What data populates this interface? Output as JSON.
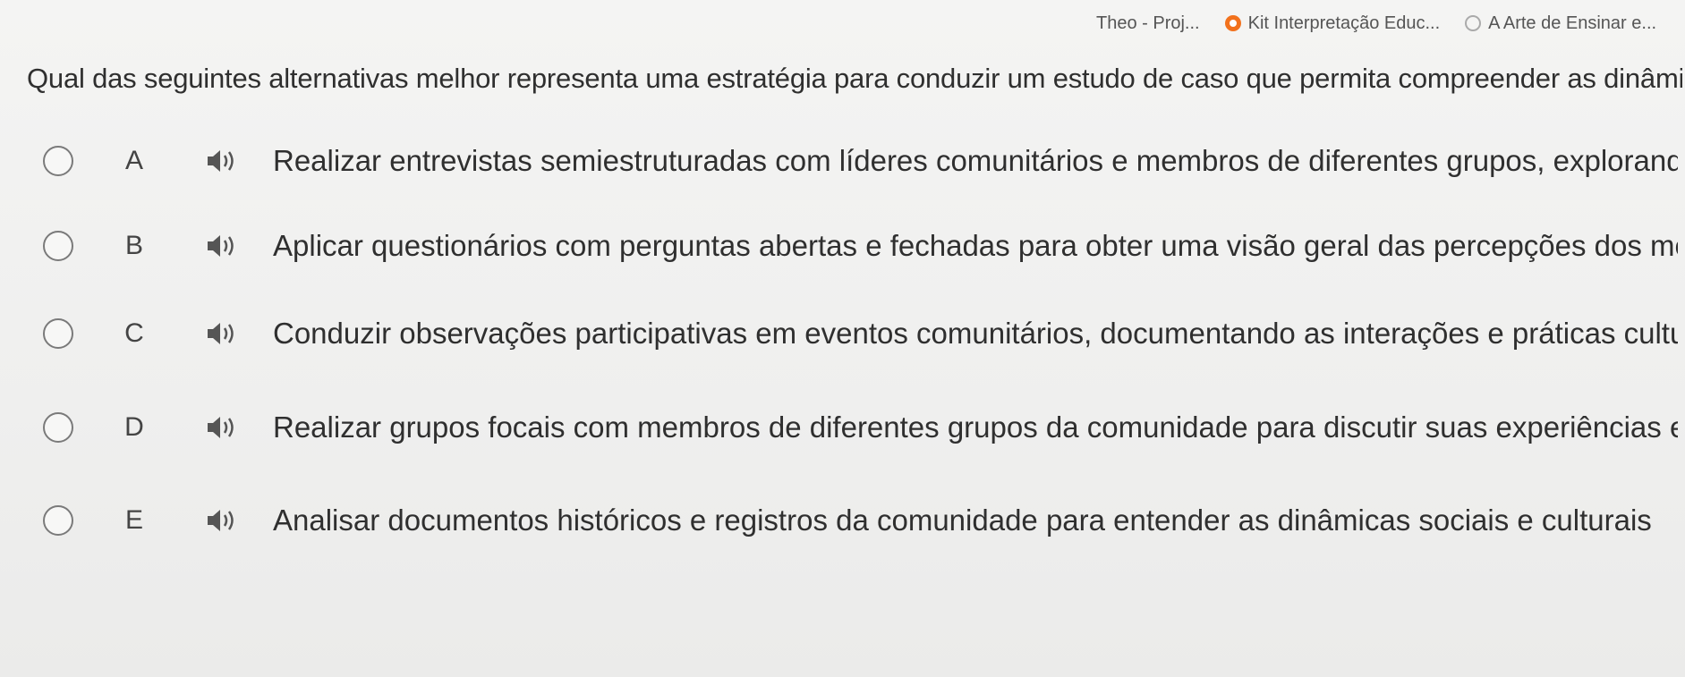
{
  "bookmarks": [
    {
      "label": "Theo - Proj...",
      "icon": "none"
    },
    {
      "label": "Kit Interpretação Educ...",
      "icon": "orange-circle-icon"
    },
    {
      "label": "A Arte de Ensinar e...",
      "icon": "gray-circle-icon"
    }
  ],
  "question": "Qual das seguintes alternativas melhor representa uma estratégia para conduzir um estudo de caso que permita compreender as dinâmicas sociais e culturais",
  "options": [
    {
      "letter": "A",
      "text": "Realizar entrevistas semiestruturadas com líderes comunitários e membros de diferentes grupos, explorando suas percepções e experiências"
    },
    {
      "letter": "B",
      "text": "Aplicar questionários com perguntas abertas e fechadas para obter uma visão geral das percepções dos membros da comunidade"
    },
    {
      "letter": "C",
      "text": "Conduzir observações participativas em eventos comunitários, documentando as interações e práticas culturais"
    },
    {
      "letter": "D",
      "text": "Realizar grupos focais com membros de diferentes grupos da comunidade para discutir suas experiências e percepções"
    },
    {
      "letter": "E",
      "text": "Analisar documentos históricos e registros da comunidade para entender as dinâmicas sociais e culturais"
    }
  ],
  "colors": {
    "text": "#2f2f2f",
    "radio_border": "#7a7a7a",
    "speaker": "#555555",
    "accent_orange": "#f2711c"
  }
}
